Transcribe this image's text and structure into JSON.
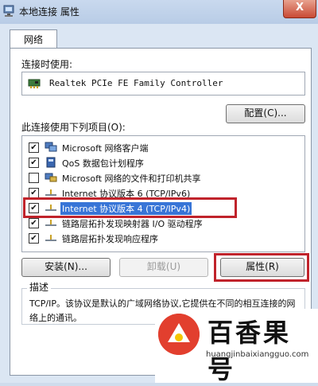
{
  "window": {
    "title": "本地连接 属性",
    "close_label": "X"
  },
  "tabs": [
    {
      "label": "网络"
    }
  ],
  "connect_using": {
    "label": "连接时使用:",
    "adapter": "Realtek PCIe FE Family Controller"
  },
  "buttons": {
    "configure": "配置(C)...",
    "install": "安装(N)...",
    "uninstall": "卸载(U)",
    "properties": "属性(R)"
  },
  "items_label": "此连接使用下列项目(O):",
  "items": [
    {
      "label": "Microsoft 网络客户端",
      "checked": true,
      "icon": "network-client-icon"
    },
    {
      "label": "QoS 数据包计划程序",
      "checked": true,
      "icon": "qos-icon"
    },
    {
      "label": "Microsoft 网络的文件和打印机共享",
      "checked": false,
      "icon": "file-share-icon"
    },
    {
      "label": "Internet 协议版本 6 (TCP/IPv6)",
      "checked": true,
      "icon": "protocol-icon"
    },
    {
      "label": "Internet 协议版本 4 (TCP/IPv4)",
      "checked": true,
      "icon": "protocol-icon",
      "selected": true
    },
    {
      "label": "链路层拓扑发现映射器 I/O 驱动程序",
      "checked": true,
      "icon": "protocol-icon"
    },
    {
      "label": "链路层拓扑发现响应程序",
      "checked": true,
      "icon": "protocol-icon"
    }
  ],
  "description": {
    "title": "描述",
    "text": "TCP/IP。该协议是默认的广域网络协议,它提供在不同的相互连接的网络上的通讯。"
  },
  "watermark": {
    "name": "百香果号",
    "url": "huangjinbaixiangguo.com"
  },
  "colors": {
    "highlight": "#c0232b",
    "selection": "#3875d7"
  }
}
